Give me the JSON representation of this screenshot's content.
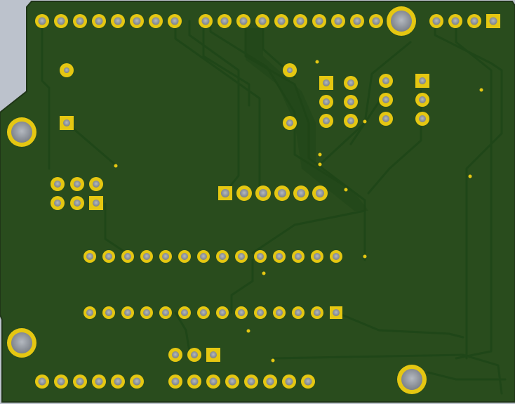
{
  "board": {
    "background_color": "#bcc2cc",
    "board_color": "#294c1d",
    "trace_color": "#1f4618",
    "copper_color": "#e5c712",
    "hole_color": "#8d9299",
    "edge_color": "#1f3517"
  },
  "components": [
    {
      "id": "header-top-left",
      "pin_count": 8,
      "pin_style": "round"
    },
    {
      "id": "header-top-middle",
      "pin_count": 10,
      "pin_style": "round"
    },
    {
      "id": "header-top-right",
      "pin_count": 4,
      "pin_style": "square-first"
    },
    {
      "id": "icsp-header",
      "pin_count": 6,
      "pin_style": "square-first"
    },
    {
      "id": "module-header",
      "pin_count": 6,
      "pin_style": "square-first"
    },
    {
      "id": "dip-ic",
      "pin_count": 28,
      "pin_style": "square-first"
    },
    {
      "id": "header-bottom-left",
      "pin_count": 6,
      "pin_style": "round"
    },
    {
      "id": "header-bottom-middle",
      "pin_count": 8,
      "pin_style": "round"
    },
    {
      "id": "three-pin-header",
      "pin_count": 3,
      "pin_style": "square-first"
    },
    {
      "id": "right-connector-left",
      "pin_count": 3,
      "pin_style": "square-first"
    },
    {
      "id": "right-connector-right",
      "pin_count": 3,
      "pin_style": "square-first"
    },
    {
      "id": "mounting-holes",
      "pin_count": 4,
      "pin_style": "large"
    }
  ]
}
